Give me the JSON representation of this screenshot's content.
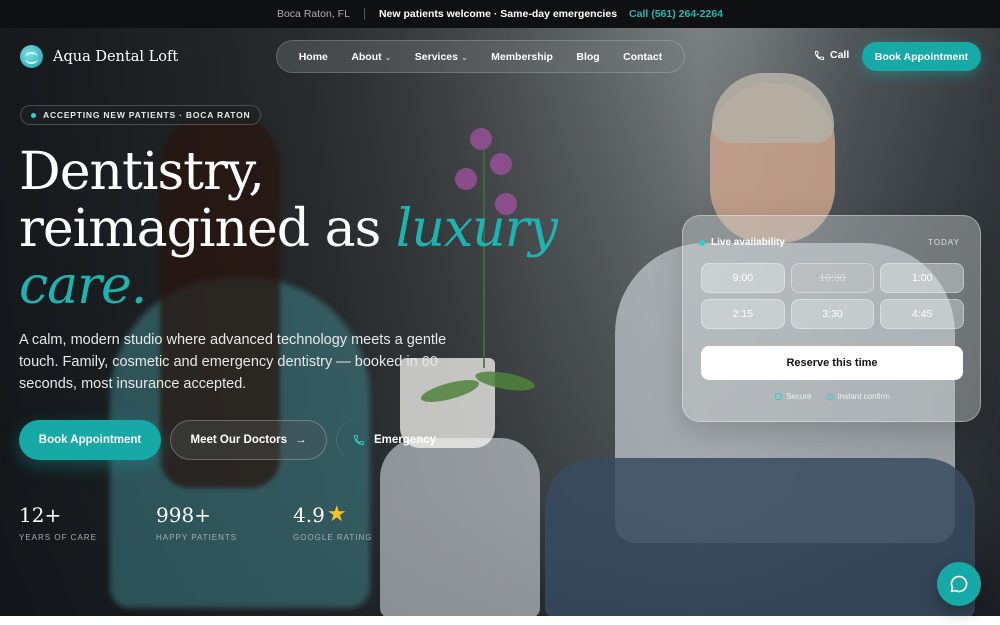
{
  "topbar": {
    "location": "Boca Raton, FL",
    "message": "New patients welcome · Same-day emergencies",
    "phone": "Call (561) 264-2264"
  },
  "brand": {
    "name": "Aqua Dental Loft"
  },
  "nav": {
    "items": [
      {
        "label": "Home"
      },
      {
        "label": "About"
      },
      {
        "label": "Services"
      },
      {
        "label": "Membership"
      },
      {
        "label": "Blog"
      },
      {
        "label": "Contact"
      }
    ],
    "call_label": "Call",
    "book_label": "Book Appointment"
  },
  "hero": {
    "badge": "ACCEPTING NEW PATIENTS · BOCA RATON",
    "headline_line1": "Dentistry,",
    "headline_line2": "reimagined as ",
    "headline_accent1": "luxury",
    "headline_accent2": "care.",
    "lead": "A calm, modern studio where advanced technology meets a gentle touch. Family, cosmetic and emergency dentistry — booked in 60 seconds, most insurance accepted.",
    "primary_button": "Book Appointment",
    "secondary_button": "Meet Our Doctors",
    "emergency_button": "Emergency"
  },
  "stats": [
    {
      "value": "12+",
      "label": "YEARS OF CARE"
    },
    {
      "value": "998+",
      "label": "HAPPY PATIENTS"
    },
    {
      "value": "4.9",
      "label": "GOOGLE RATING"
    }
  ],
  "availability": {
    "title": "Live availability",
    "day": "TODAY",
    "slots": [
      {
        "time": "9:00",
        "available": true
      },
      {
        "time": "10:30",
        "available": false
      },
      {
        "time": "1:00",
        "available": true
      },
      {
        "time": "2:15",
        "available": true
      },
      {
        "time": "3:30",
        "available": true
      },
      {
        "time": "4:45",
        "available": true
      }
    ],
    "reserve_label": "Reserve this time",
    "foot_secure": "Secure",
    "foot_confirm": "Instant confirm"
  },
  "colors": {
    "accent": "#17a9a6",
    "star": "#f4c22b",
    "topbar": "#0e1011"
  }
}
